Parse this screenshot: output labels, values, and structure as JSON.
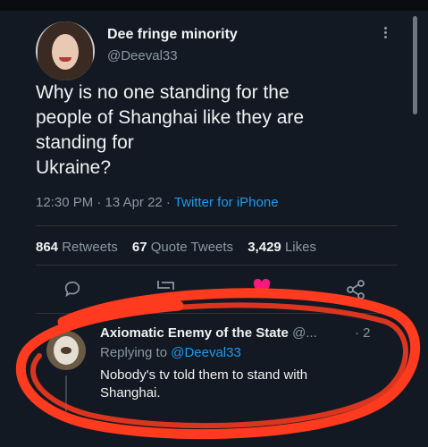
{
  "tweet": {
    "author_name": "Dee fringe minority",
    "author_handle": "@Deeval33",
    "text_lines": [
      "Why is no one standing for the",
      "people of Shanghai like they are",
      "standing for",
      "Ukraine?"
    ],
    "time": "12:30 PM · 13 Apr 22 · ",
    "source": "Twitter for iPhone"
  },
  "stats": {
    "retweets_count": "864",
    "retweets_label": "Retweets",
    "quotes_count": "67",
    "quotes_label": "Quote Tweets",
    "likes_count": "3,429",
    "likes_label": "Likes"
  },
  "reply": {
    "author_name": "Axiomatic Enemy of the State",
    "author_handle": "@...",
    "time": "· 2",
    "replying_prefix": "Replying to ",
    "replying_handle": "@Deeval33",
    "text_lines": [
      "Nobody's tv told them to stand with",
      "Shanghai."
    ]
  },
  "colors": {
    "accent": "#1d9bf0",
    "like": "#f91880",
    "annotation": "#ff3b1f",
    "background": "#121922"
  },
  "icons": [
    "reply-icon",
    "retweet-icon",
    "like-icon",
    "share-icon",
    "more-icon"
  ]
}
